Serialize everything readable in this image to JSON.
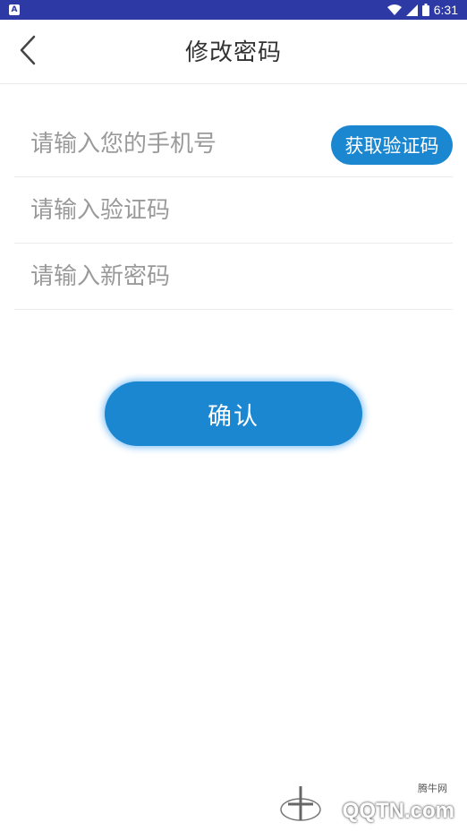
{
  "status_bar": {
    "notification_glyph": "A",
    "time": "6:31",
    "icons": [
      "wifi-icon",
      "signal-icon",
      "battery-icon"
    ]
  },
  "header": {
    "title": "修改密码",
    "back_icon": "chevron-left-icon"
  },
  "form": {
    "phone_placeholder": "请输入您的手机号",
    "get_code_label": "获取验证码",
    "code_placeholder": "请输入验证码",
    "new_password_placeholder": "请输入新密码"
  },
  "confirm_label": "确认",
  "watermark": {
    "caption": "腾牛网",
    "text": "QQTN.com"
  },
  "colors": {
    "status_bar": "#2d3aa5",
    "primary": "#1b87d1",
    "placeholder": "#9a9a9a",
    "divider": "#ececec"
  }
}
